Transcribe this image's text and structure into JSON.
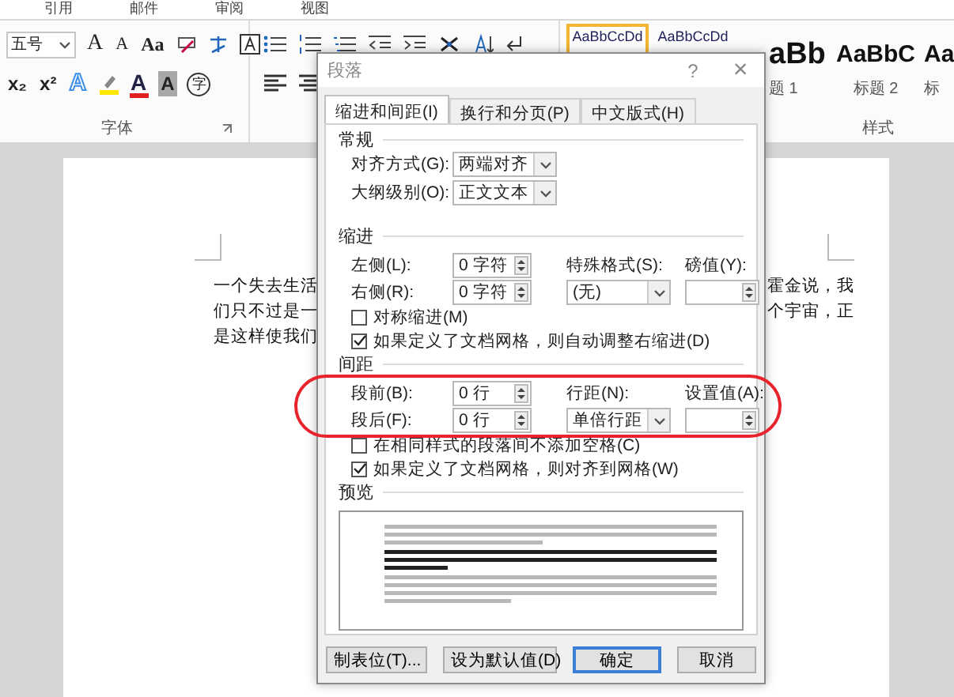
{
  "ribbon_tabs": [
    {
      "label": "引用"
    },
    {
      "label": "邮件"
    },
    {
      "label": "审阅"
    },
    {
      "label": "视图"
    }
  ],
  "font_group": {
    "size_box": "五号",
    "row1_glyphs": [
      {
        "kind": "grow",
        "text": "A"
      },
      {
        "kind": "shrink",
        "text": "A"
      },
      {
        "kind": "case",
        "text": "Aa"
      }
    ],
    "row2_glyphs": [
      {
        "kind": "sub",
        "text": "x₂"
      },
      {
        "kind": "sup",
        "text": "x²"
      },
      {
        "kind": "effect",
        "text": "A"
      },
      {
        "kind": "color",
        "text": "A"
      },
      {
        "kind": "shade",
        "text": "A"
      },
      {
        "kind": "enclose",
        "text": "字"
      }
    ],
    "label": "字体"
  },
  "styles_group": {
    "label": "样式",
    "styles": [
      {
        "kind": "small",
        "sample": "AaBbCcDd",
        "selected": true
      },
      {
        "kind": "small",
        "sample": "AaBbCcDd",
        "selected": false
      },
      {
        "kind": "large_cut",
        "sample": "aBb",
        "name": "题 1",
        "selected": false
      },
      {
        "kind": "medium",
        "sample": "AaBbC",
        "name": "标题 2",
        "selected": false
      },
      {
        "kind": "medium_cut",
        "sample": "Aa",
        "name": "标",
        "selected": false
      }
    ]
  },
  "document": {
    "left_lines": [
      "一个失去生活",
      "们只不过是一",
      "是这样使我们"
    ],
    "right_lines": [
      "霍金说，我",
      "个宇宙，正"
    ]
  },
  "dialog": {
    "title": "段落",
    "help": "?",
    "close": "×",
    "tabs": [
      {
        "label": "缩进和间距(I)",
        "selected": true
      },
      {
        "label": "换行和分页(P)",
        "selected": false
      },
      {
        "label": "中文版式(H)",
        "selected": false
      }
    ],
    "general": {
      "heading": "常规",
      "alignment": {
        "label": "对齐方式(G):",
        "value": "两端对齐"
      },
      "outline": {
        "label": "大纲级别(O):",
        "value": "正文文本"
      }
    },
    "indent": {
      "heading": "缩进",
      "left": {
        "label": "左侧(L):",
        "value": "0 字符"
      },
      "special": {
        "label": "特殊格式(S):",
        "value": "(无)"
      },
      "by": {
        "label": "磅值(Y):"
      },
      "right": {
        "label": "右侧(R):",
        "value": "0 字符"
      },
      "checkboxes": [
        {
          "label": "对称缩进(M)",
          "checked": false
        },
        {
          "label": "如果定义了文档网格，则自动调整右缩进(D)",
          "checked": true
        }
      ]
    },
    "spacing": {
      "heading": "间距",
      "before": {
        "label": "段前(B):",
        "value": "0 行"
      },
      "line_spacing": {
        "label": "行距(N):",
        "value": "单倍行距"
      },
      "at": {
        "label": "设置值(A):"
      },
      "after": {
        "label": "段后(F):",
        "value": "0 行"
      },
      "checkboxes": [
        {
          "label": "在相同样式的段落间不添加空格(C)",
          "checked": false
        },
        {
          "label": "如果定义了文档网格，则对齐到网格(W)",
          "checked": true
        }
      ]
    },
    "preview": {
      "heading": "预览"
    },
    "buttons": [
      {
        "label": "制表位(T)...",
        "default": false
      },
      {
        "label": "设为默认值(D)",
        "default": false
      },
      {
        "label": "确定",
        "default": true
      },
      {
        "label": "取消",
        "default": false
      }
    ]
  }
}
